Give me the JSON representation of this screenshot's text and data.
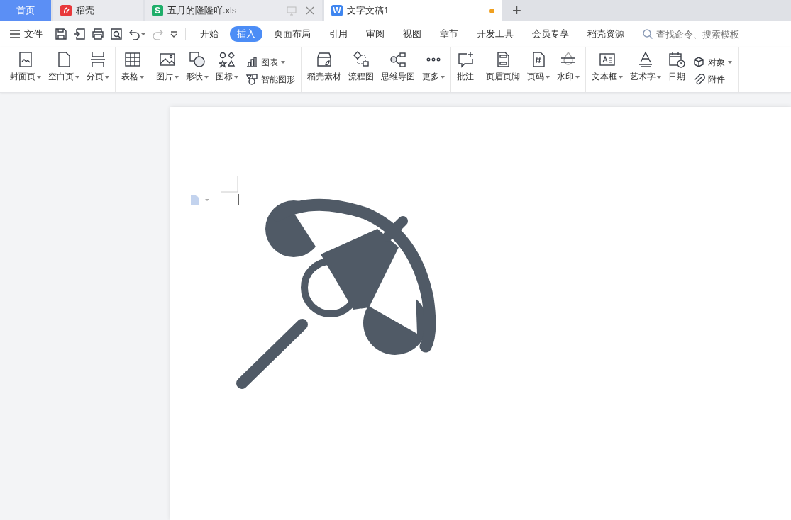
{
  "tabs": [
    {
      "label": "首页",
      "kind": "home",
      "selected": false
    },
    {
      "label": "稻壳",
      "kind": "app",
      "selected": false,
      "color": "#e8393b"
    },
    {
      "label": "五月的隆隆吖.xls",
      "kind": "file",
      "badge": "S",
      "color": "#1fae6a",
      "selected": false,
      "closable": true,
      "modified": false
    },
    {
      "label": "文字文稿1",
      "kind": "file",
      "badge": "W",
      "color": "#3f86f0",
      "selected": true,
      "closable": false,
      "modified": true
    }
  ],
  "new_tab": "+",
  "menubar": {
    "file": "文件",
    "ribbon_tabs": [
      {
        "label": "开始",
        "selected": false
      },
      {
        "label": "插入",
        "selected": true
      },
      {
        "label": "页面布局",
        "selected": false
      },
      {
        "label": "引用",
        "selected": false
      },
      {
        "label": "审阅",
        "selected": false
      },
      {
        "label": "视图",
        "selected": false
      },
      {
        "label": "章节",
        "selected": false
      },
      {
        "label": "开发工具",
        "selected": false
      },
      {
        "label": "会员专享",
        "selected": false
      },
      {
        "label": "稻壳资源",
        "selected": false
      }
    ],
    "search": {
      "placeholder": "查找命令、搜索模板"
    }
  },
  "ribbon": {
    "groups": [
      {
        "items": [
          {
            "kind": "large",
            "label": "封面页",
            "dropdown": true
          },
          {
            "kind": "large",
            "label": "空白页",
            "dropdown": true
          },
          {
            "kind": "large",
            "label": "分页",
            "dropdown": true
          }
        ]
      },
      {
        "items": [
          {
            "kind": "large",
            "label": "表格",
            "dropdown": true
          }
        ]
      },
      {
        "items": [
          {
            "kind": "large",
            "label": "图片",
            "dropdown": true
          },
          {
            "kind": "large",
            "label": "形状",
            "dropdown": true
          },
          {
            "kind": "large",
            "label": "图标",
            "dropdown": true
          },
          {
            "kind": "stack",
            "items": [
              {
                "label": "图表",
                "dropdown": true
              },
              {
                "label": "智能图形",
                "dropdown": false
              }
            ]
          }
        ]
      },
      {
        "items": [
          {
            "kind": "large",
            "label": "稻壳素材",
            "dropdown": false
          },
          {
            "kind": "large",
            "label": "流程图",
            "dropdown": false
          },
          {
            "kind": "large",
            "label": "思维导图",
            "dropdown": false
          },
          {
            "kind": "large",
            "label": "更多",
            "dropdown": true
          }
        ]
      },
      {
        "items": [
          {
            "kind": "large",
            "label": "批注",
            "dropdown": false
          }
        ]
      },
      {
        "items": [
          {
            "kind": "large",
            "label": "页眉页脚",
            "dropdown": false
          },
          {
            "kind": "large",
            "label": "页码",
            "dropdown": true
          },
          {
            "kind": "large",
            "label": "水印",
            "dropdown": true
          }
        ]
      },
      {
        "items": [
          {
            "kind": "large",
            "label": "文本框",
            "dropdown": true
          },
          {
            "kind": "large",
            "label": "艺术字",
            "dropdown": true
          },
          {
            "kind": "large",
            "label": "日期",
            "dropdown": false
          },
          {
            "kind": "stack",
            "items": [
              {
                "label": "对象",
                "dropdown": true
              },
              {
                "label": "附件",
                "dropdown": false
              }
            ]
          }
        ]
      }
    ]
  }
}
